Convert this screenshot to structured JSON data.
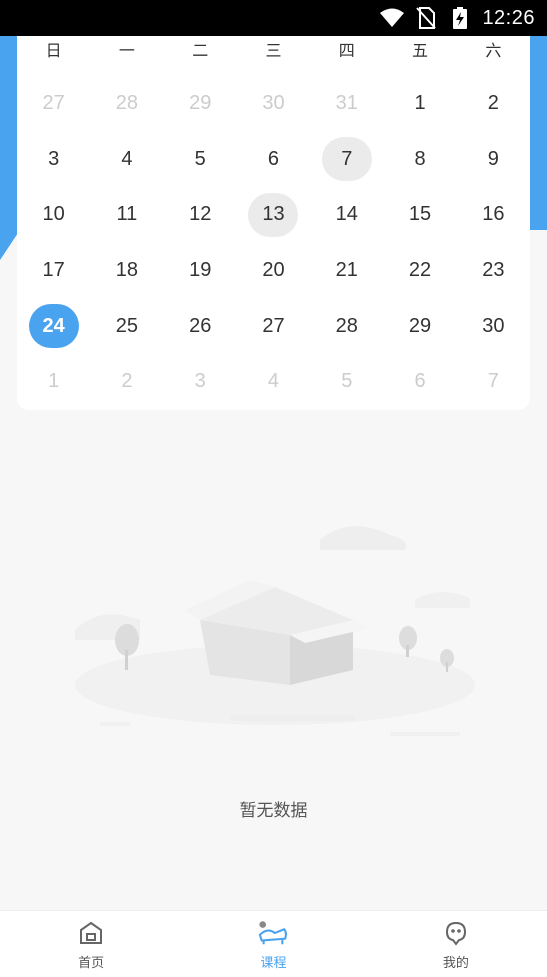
{
  "status_bar": {
    "time": "12:26"
  },
  "calendar": {
    "weekdays": [
      "日",
      "一",
      "二",
      "三",
      "四",
      "五",
      "六"
    ],
    "weeks": [
      [
        {
          "d": "27",
          "m": true
        },
        {
          "d": "28",
          "m": true
        },
        {
          "d": "29",
          "m": true
        },
        {
          "d": "30",
          "m": true
        },
        {
          "d": "31",
          "m": true
        },
        {
          "d": "1"
        },
        {
          "d": "2"
        }
      ],
      [
        {
          "d": "3"
        },
        {
          "d": "4"
        },
        {
          "d": "5"
        },
        {
          "d": "6"
        },
        {
          "d": "7",
          "mark": true
        },
        {
          "d": "8"
        },
        {
          "d": "9"
        }
      ],
      [
        {
          "d": "10"
        },
        {
          "d": "11"
        },
        {
          "d": "12"
        },
        {
          "d": "13",
          "mark": true
        },
        {
          "d": "14"
        },
        {
          "d": "15"
        },
        {
          "d": "16"
        }
      ],
      [
        {
          "d": "17"
        },
        {
          "d": "18"
        },
        {
          "d": "19"
        },
        {
          "d": "20"
        },
        {
          "d": "21"
        },
        {
          "d": "22"
        },
        {
          "d": "23"
        }
      ],
      [
        {
          "d": "24",
          "sel": true
        },
        {
          "d": "25"
        },
        {
          "d": "26"
        },
        {
          "d": "27"
        },
        {
          "d": "28"
        },
        {
          "d": "29"
        },
        {
          "d": "30"
        }
      ],
      [
        {
          "d": "1",
          "m": true
        },
        {
          "d": "2",
          "m": true
        },
        {
          "d": "3",
          "m": true
        },
        {
          "d": "4",
          "m": true
        },
        {
          "d": "5",
          "m": true
        },
        {
          "d": "6",
          "m": true
        },
        {
          "d": "7",
          "m": true
        }
      ]
    ]
  },
  "empty_state": {
    "text": "暂无数据"
  },
  "bottom_nav": {
    "items": [
      {
        "label": "首页",
        "icon": "home-icon",
        "active": false
      },
      {
        "label": "课程",
        "icon": "course-icon",
        "active": true
      },
      {
        "label": "我的",
        "icon": "profile-icon",
        "active": false
      }
    ]
  },
  "colors": {
    "accent": "#4aa3ef",
    "marked": "#ebebeb",
    "muted": "#cccccc"
  }
}
